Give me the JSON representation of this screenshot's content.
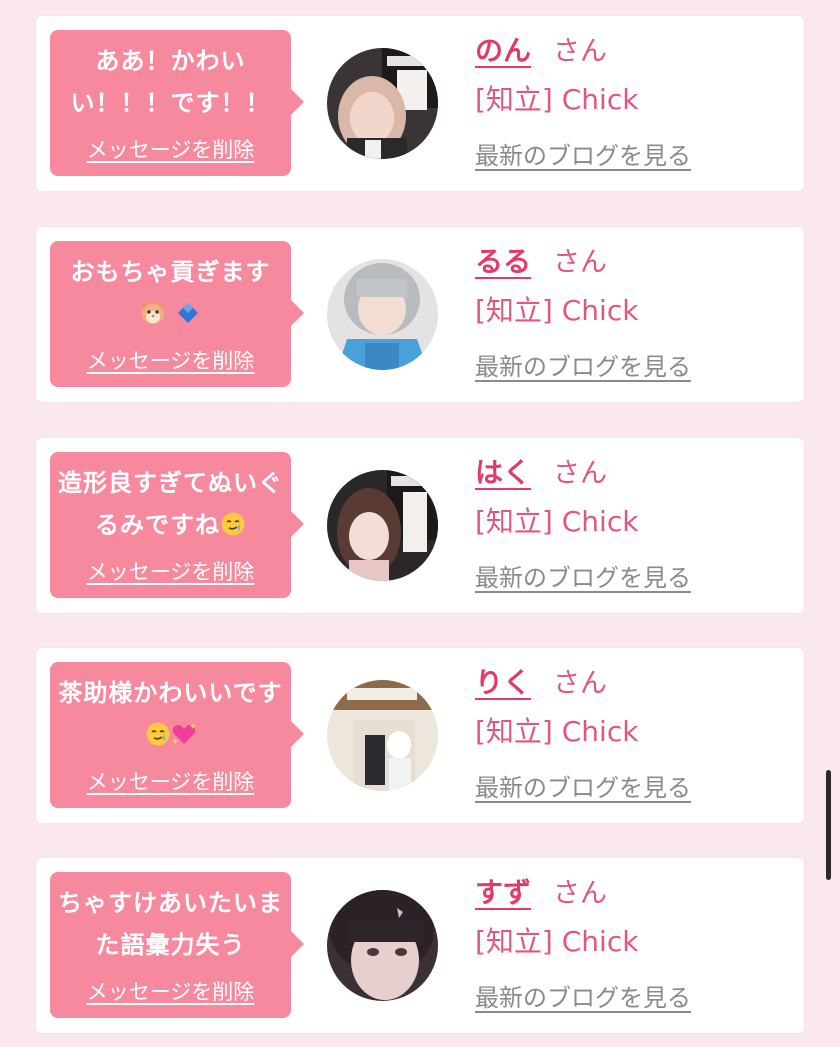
{
  "delete_label": "メッセージを削除",
  "san_label": "さん",
  "blog_label": "最新のブログを見る",
  "group_label": "[知立] Chick",
  "colors": {
    "background": "#fbe7ee",
    "bubble": "#f7899e",
    "name": "#e33a6a",
    "group": "#e0587d",
    "link_gray": "#8a8a8a"
  },
  "messages": [
    {
      "text": "ああ！かわいい！！！です！！",
      "emojis": [],
      "name": "のん",
      "avatar": "avatar-photo-non"
    },
    {
      "text": "おもちゃ貢ぎます",
      "emojis": [
        "hamster-emoji",
        "blue-diamond-emoji"
      ],
      "name": "るる",
      "avatar": "avatar-photo-ruru"
    },
    {
      "text": "造形良すぎてぬいぐるみですね",
      "emojis": [
        "teary-smile-emoji"
      ],
      "name": "はく",
      "avatar": "avatar-photo-haku"
    },
    {
      "text": "茶助様かわいいです",
      "emojis": [
        "teary-smile-emoji",
        "sparkling-heart-emoji"
      ],
      "name": "りく",
      "avatar": "avatar-photo-riku"
    },
    {
      "text": "ちゃすけあいたいまた語彙力失う",
      "emojis": [],
      "name": "すず",
      "avatar": "avatar-photo-suzu"
    }
  ]
}
